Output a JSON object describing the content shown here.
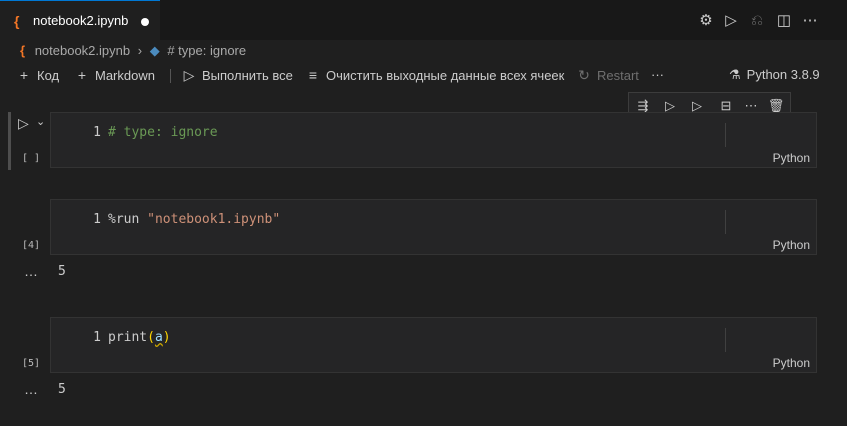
{
  "tab": {
    "icon": "jupyter-icon",
    "title": "notebook2.ipynb",
    "modified": true
  },
  "title_actions": [
    {
      "icon": "gear-icon"
    },
    {
      "icon": "run-icon"
    },
    {
      "icon": "debug-icon"
    },
    {
      "icon": "split-editor-icon"
    },
    {
      "icon": "more-icon"
    }
  ],
  "breadcrumb": {
    "file": "notebook2.ipynb",
    "symbol": "# type: ignore"
  },
  "toolbar": {
    "add_code": "Код",
    "add_markdown": "Markdown",
    "run_all": "Выполнить все",
    "clear_outputs": "Очистить выходные данные всех ячеек",
    "restart": "Restart",
    "more": "···"
  },
  "kernel": {
    "label": "Python 3.8.9"
  },
  "cell_toolbar": [
    "execute-above-icon",
    "execute-below-icon",
    "execute-cell-below-icon",
    "split-cell-icon",
    "more-icon",
    "delete-icon"
  ],
  "cells": [
    {
      "exec": "[ ]",
      "line": "1",
      "code": "# type: ignore",
      "lang": "Python",
      "output": ""
    },
    {
      "exec": "[4]",
      "line": "1",
      "code_parts": [
        "%run ",
        "\"notebook1.ipynb\""
      ],
      "lang": "Python",
      "output_dots": "…",
      "output": "5"
    },
    {
      "exec": "[5]",
      "line": "1",
      "code_parts": [
        "print",
        "(",
        "a",
        ")"
      ],
      "lang": "Python",
      "output_dots": "…",
      "output": "5"
    }
  ]
}
